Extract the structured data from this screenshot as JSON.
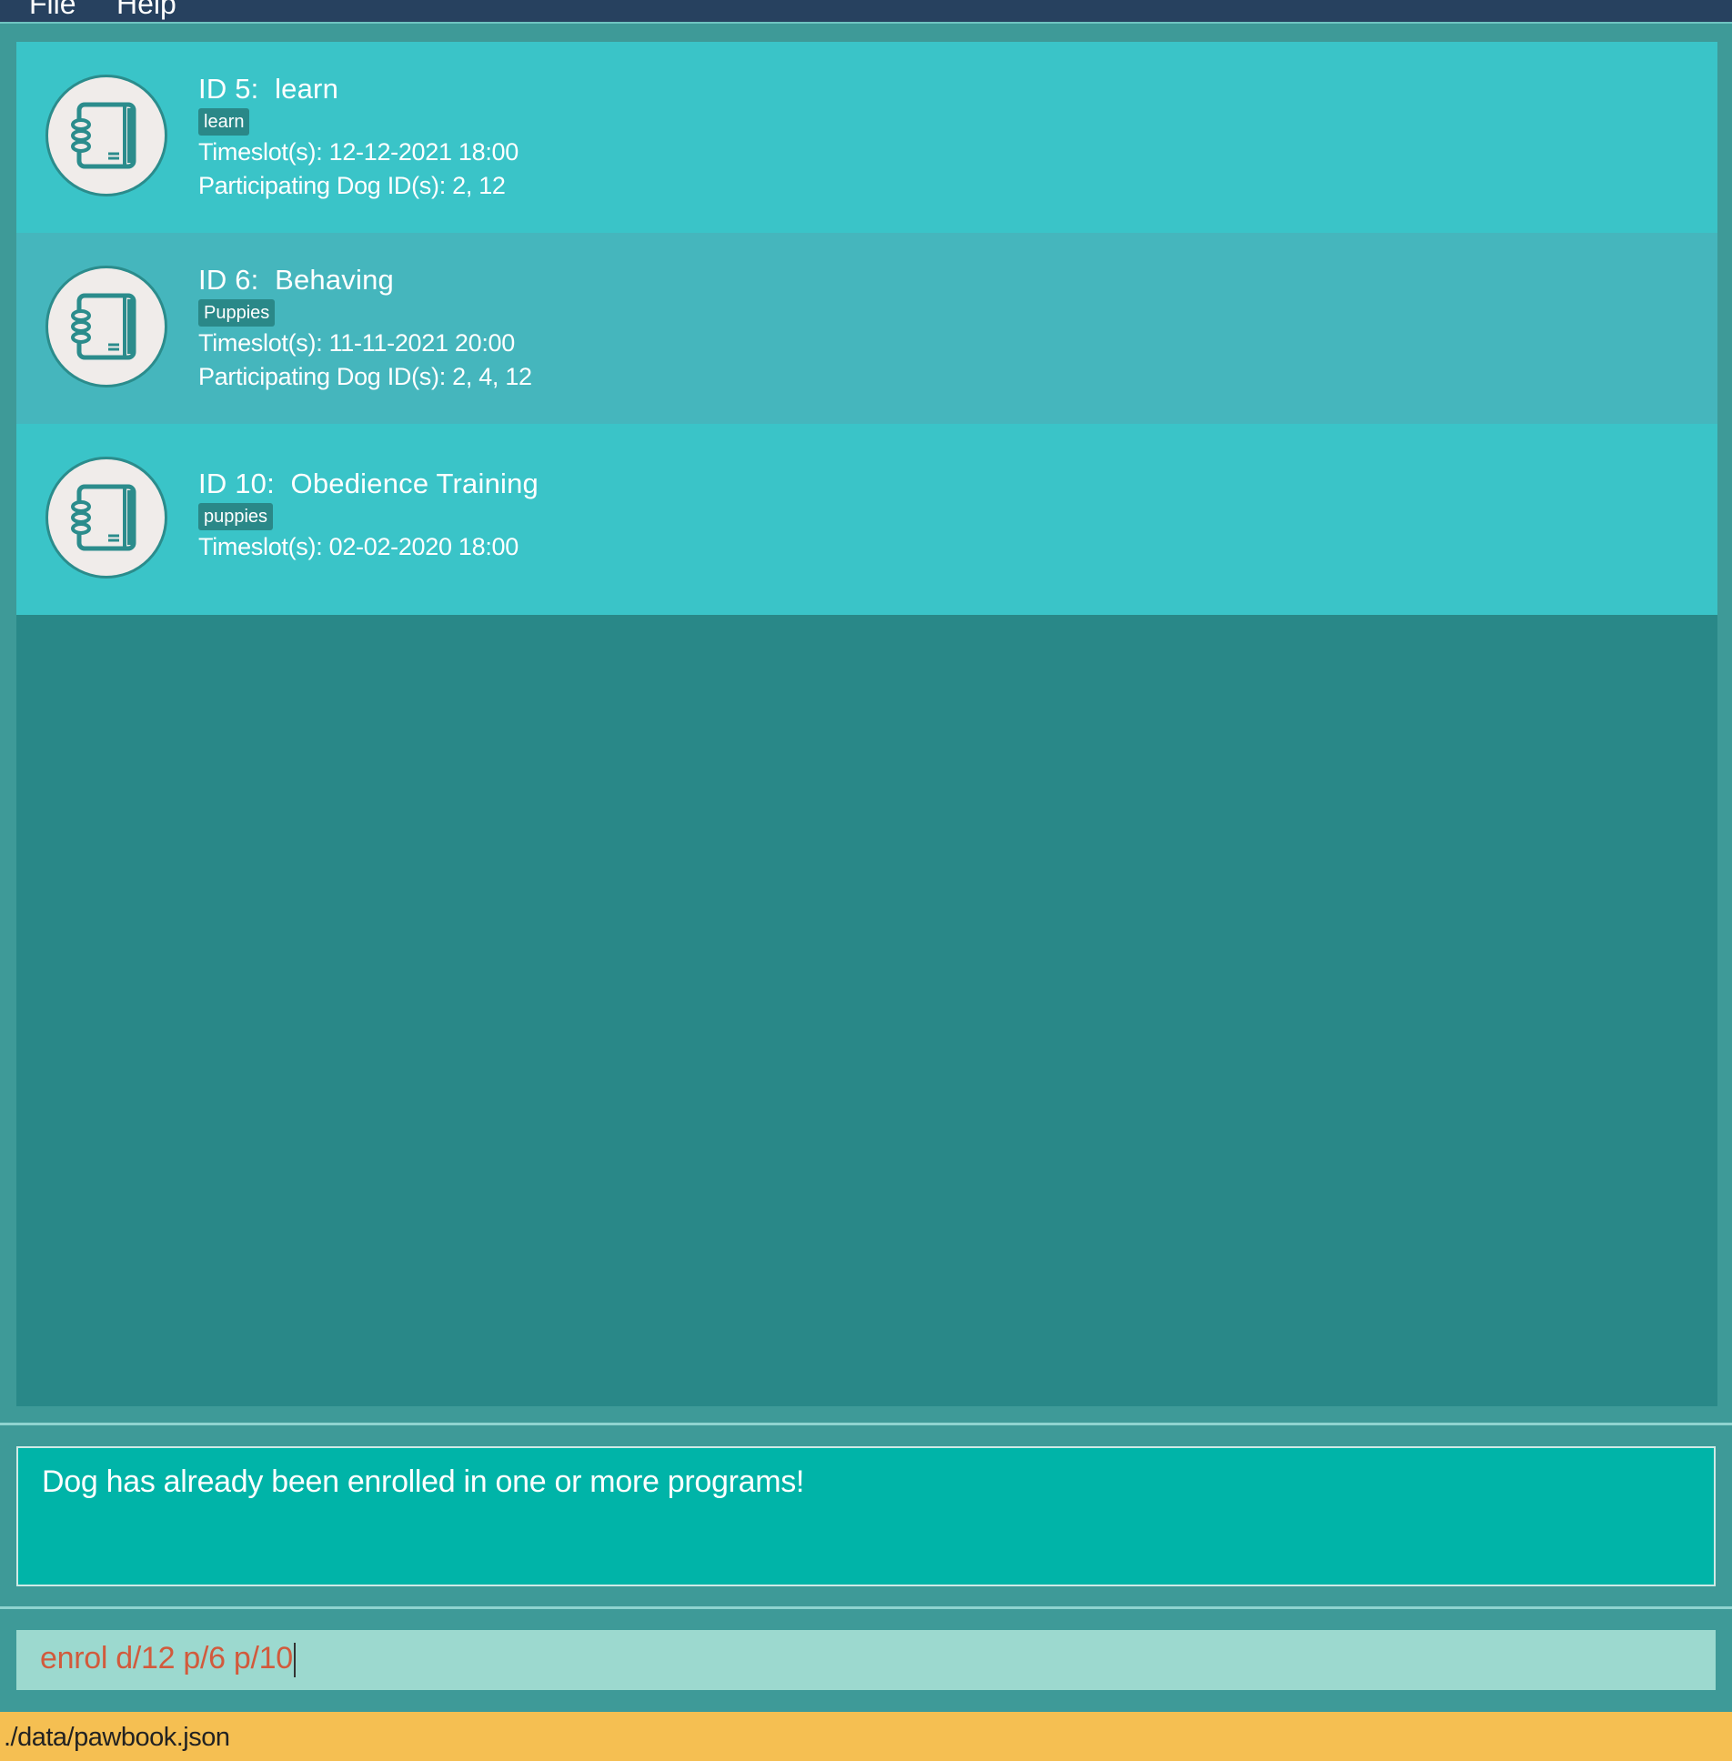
{
  "menu": {
    "file_label": "File",
    "help_label": "Help"
  },
  "programs": [
    {
      "title": "ID 5:  learn",
      "tag": "learn",
      "timeslots": "Timeslot(s): 12-12-2021 18:00",
      "dogs": "Participating Dog ID(s): 2, 12",
      "icon": "notebook-icon"
    },
    {
      "title": "ID 6:  Behaving",
      "tag": "Puppies",
      "timeslots": "Timeslot(s): 11-11-2021 20:00",
      "dogs": "Participating Dog ID(s): 2, 4, 12",
      "icon": "notebook-icon"
    },
    {
      "title": "ID 10:  Obedience Training",
      "tag": "puppies",
      "timeslots": "Timeslot(s): 02-02-2020 18:00",
      "icon": "notebook-icon"
    }
  ],
  "result_display": {
    "message": "Dog has already been enrolled in one or more programs!"
  },
  "command_box": {
    "value": "enrol d/12 p/6 p/10"
  },
  "status_bar": {
    "file_path": "./data/pawbook.json"
  },
  "colors": {
    "menubar": "#27415f",
    "card_light": "#3ac4c8",
    "card_dark": "#45b6bd",
    "list_background": "#298888",
    "result_background": "#00b4a8",
    "command_background": "#9cd9cf",
    "command_text": "#d25a3c",
    "status_background": "#f5bf52"
  }
}
